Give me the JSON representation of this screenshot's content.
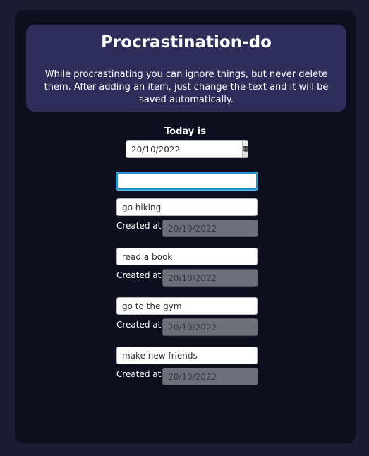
{
  "header": {
    "title": "Procrastination-do",
    "description": "While procrastinating you can ignore things, but never delete them. After adding an item, just change the text and it will be saved automatically."
  },
  "today": {
    "label": "Today is",
    "date": "20/10/2022"
  },
  "new_item": {
    "value": "",
    "placeholder": ""
  },
  "created_label": "Created at",
  "items": [
    {
      "text": "go hiking",
      "created": "20/10/2022"
    },
    {
      "text": "read a book",
      "created": "20/10/2022"
    },
    {
      "text": "go to the gym",
      "created": "20/10/2022"
    },
    {
      "text": "make new friends",
      "created": "20/10/2022"
    }
  ],
  "calendar_icon": "calendar-icon"
}
